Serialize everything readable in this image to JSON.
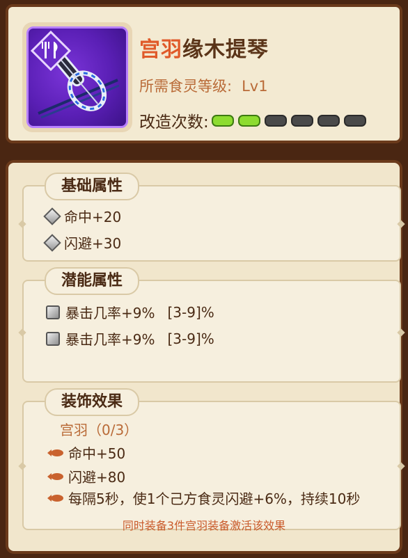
{
  "item": {
    "name_highlight": "宫羽",
    "name_rest": "缘木提琴",
    "required_level_label": "所需食灵等级:",
    "required_level_value": "Lv1",
    "modify_label": "改造次数:",
    "modify_progress": {
      "filled": 2,
      "total": 6
    },
    "icon_name": "violin-icon",
    "type_icon_name": "fork-knife-icon"
  },
  "sections": {
    "basic": {
      "title": "基础属性",
      "stats": [
        "命中+20",
        "闪避+30"
      ]
    },
    "potential": {
      "title": "潜能属性",
      "stats": [
        {
          "text": "暴击几率+9%",
          "range": "[3-9]%"
        },
        {
          "text": "暴击几率+9%",
          "range": "[3-9]%"
        }
      ]
    },
    "decoration": {
      "title": "装饰效果",
      "set_name": "宫羽（0/3）",
      "effects": [
        "命中+50",
        "闪避+80",
        "每隔5秒，使1个己方食灵闪避+6%，持续10秒"
      ]
    }
  },
  "footer_note": "同时装备3件宫羽装备激活该效果",
  "colors": {
    "accent": "#e05a2a",
    "pip_on": "#8ddc30",
    "pip_off": "#4a4a4a",
    "frame": "#6b3a1b"
  }
}
